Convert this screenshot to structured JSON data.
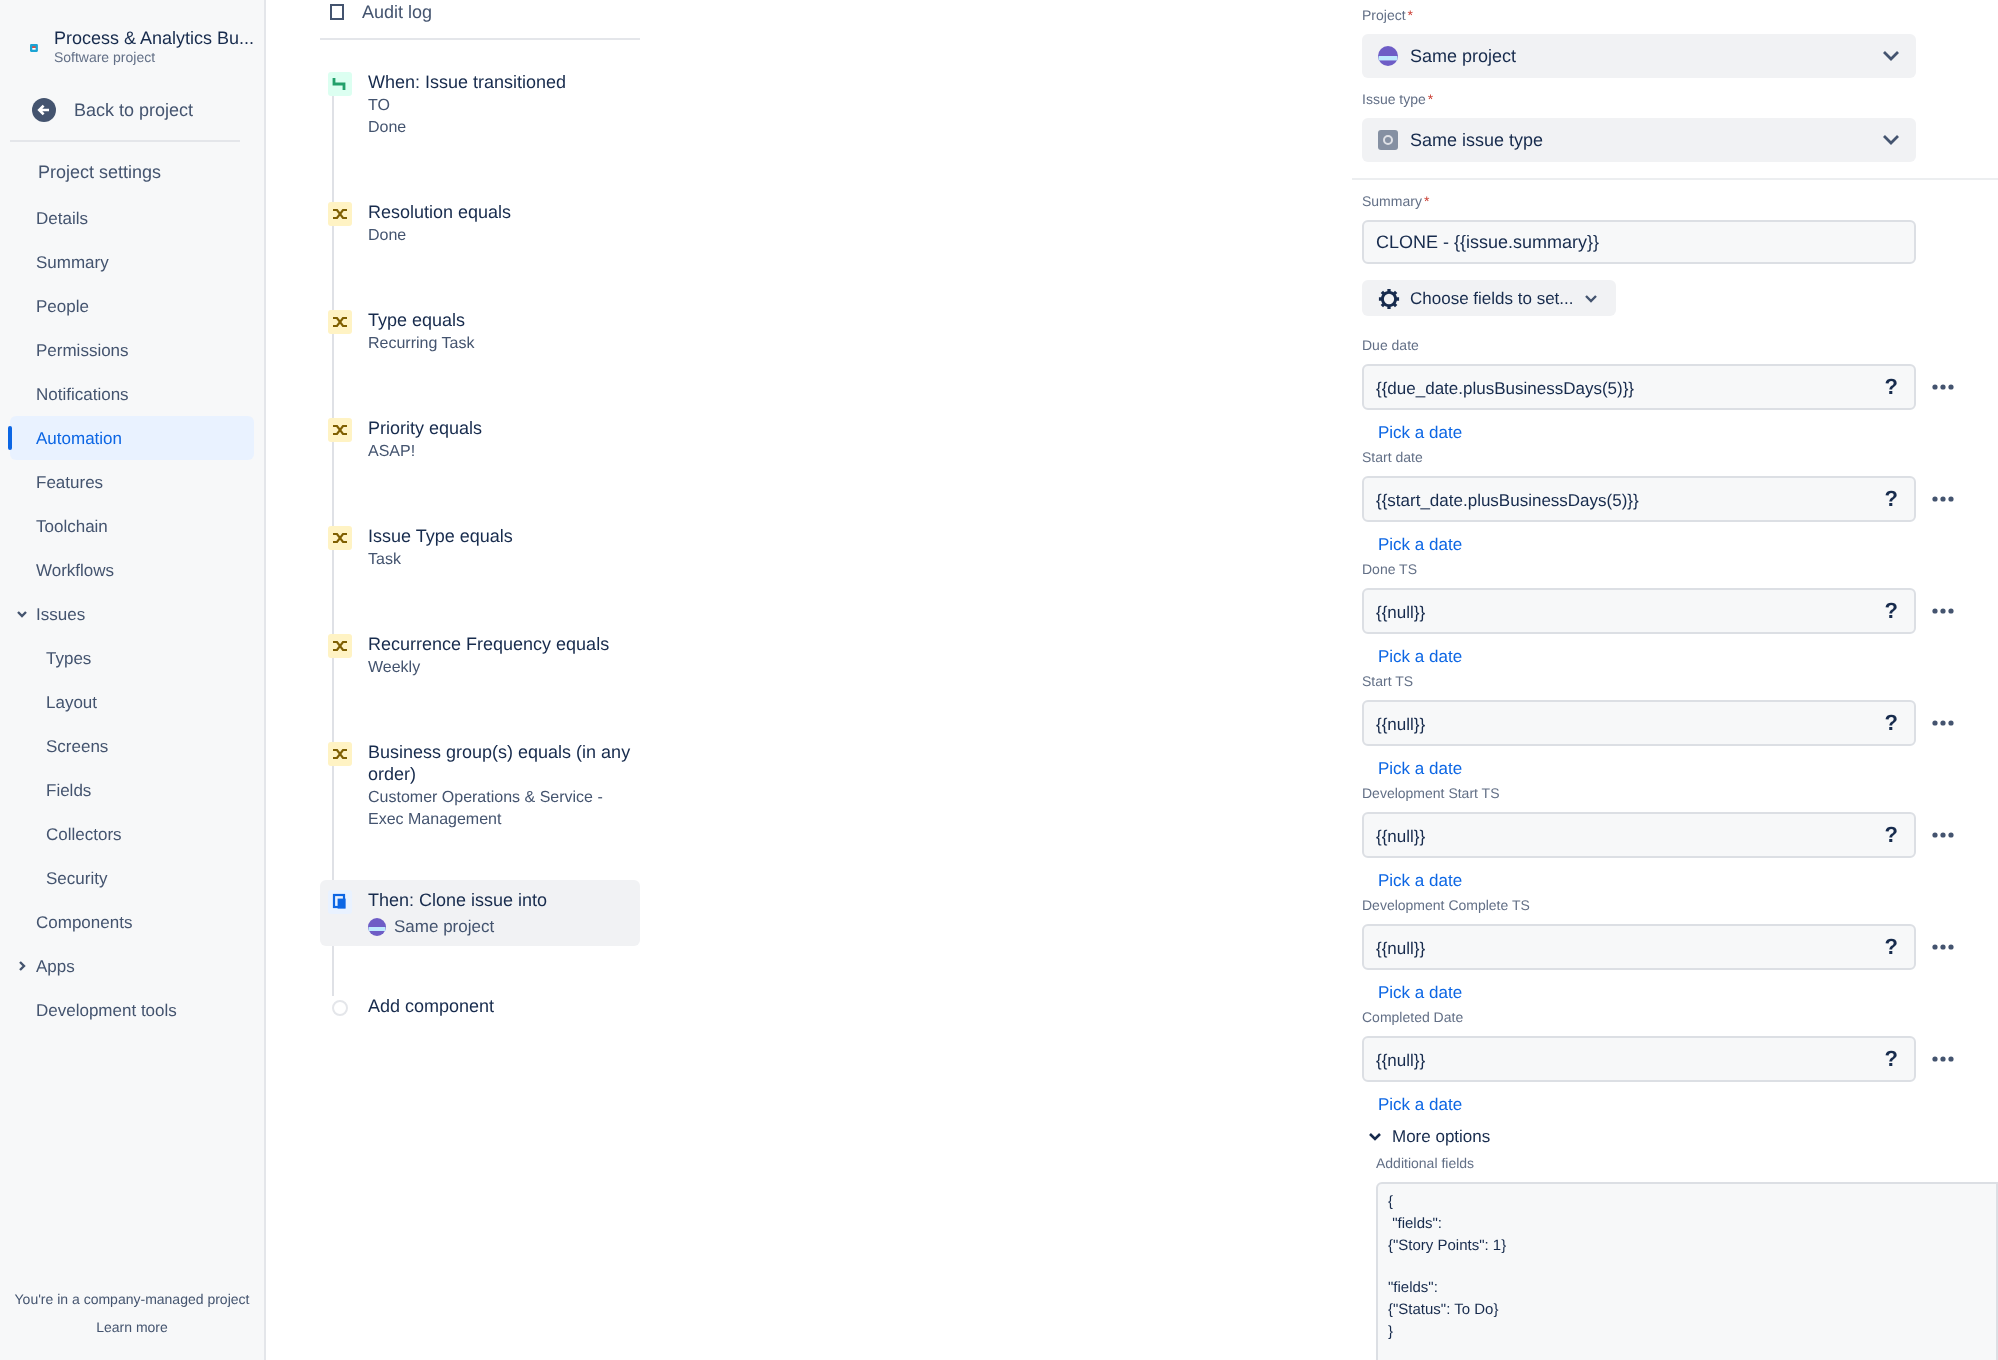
{
  "sidebar": {
    "project": {
      "name": "Process & Analytics Bu...",
      "type": "Software project"
    },
    "back_link": "Back to project",
    "section_title": "Project settings",
    "items": [
      {
        "label": "Details",
        "selected": false
      },
      {
        "label": "Summary",
        "selected": false
      },
      {
        "label": "People",
        "selected": false
      },
      {
        "label": "Permissions",
        "selected": false
      },
      {
        "label": "Notifications",
        "selected": false
      },
      {
        "label": "Automation",
        "selected": true
      },
      {
        "label": "Features",
        "selected": false
      },
      {
        "label": "Toolchain",
        "selected": false
      },
      {
        "label": "Workflows",
        "selected": false
      },
      {
        "label": "Issues",
        "selected": false,
        "expanded": true,
        "children": [
          {
            "label": "Types",
            "selected": false
          },
          {
            "label": "Layout",
            "selected": false
          },
          {
            "label": "Screens",
            "selected": false
          },
          {
            "label": "Fields",
            "selected": false
          },
          {
            "label": "Collectors",
            "selected": false
          },
          {
            "label": "Security",
            "selected": false
          }
        ]
      },
      {
        "label": "Components",
        "selected": false
      },
      {
        "label": "Apps",
        "selected": false,
        "expanded": false
      },
      {
        "label": "Development tools",
        "selected": false
      }
    ],
    "footer": {
      "text": "You're in a company-managed project",
      "link": "Learn more"
    }
  },
  "rule": {
    "audit_log": "Audit log",
    "steps": [
      {
        "kind": "trigger",
        "title": "When: Issue transitioned",
        "details": [
          "TO",
          "Done"
        ],
        "selected": false
      },
      {
        "kind": "condition",
        "title": "Resolution equals",
        "details": [
          "Done"
        ],
        "selected": false
      },
      {
        "kind": "condition",
        "title": "Type equals",
        "details": [
          "Recurring Task"
        ],
        "selected": false
      },
      {
        "kind": "condition",
        "title": "Priority equals",
        "details": [
          "ASAP!"
        ],
        "selected": false
      },
      {
        "kind": "condition",
        "title": "Issue Type equals",
        "details": [
          "Task"
        ],
        "selected": false
      },
      {
        "kind": "condition",
        "title": "Recurrence Frequency equals",
        "details": [
          "Weekly"
        ],
        "selected": false
      },
      {
        "kind": "condition",
        "title": "Business group(s) equals (in any order)",
        "details": [
          "Customer Operations & Service - Exec Management"
        ],
        "selected": false
      },
      {
        "kind": "action",
        "title": "Then: Clone issue into",
        "project": "Same project",
        "selected": true
      },
      {
        "kind": "add",
        "title": "Add component",
        "selected": false
      }
    ]
  },
  "form": {
    "selects": [
      {
        "kind": "project",
        "label": "Project",
        "required_mark": "*",
        "value": "Same project"
      },
      {
        "kind": "issue_type",
        "label": "Issue type",
        "required_mark": "*",
        "value": "Same issue type"
      }
    ],
    "summary": {
      "label": "Summary",
      "required_mark": "*",
      "value": "CLONE - {{issue.summary}}"
    },
    "choose_fields_button": "Choose fields to set...",
    "date_fields": [
      {
        "label": "Due date",
        "value": "{{due_date.plusBusinessDays(5)}}",
        "help": "?",
        "link": "Pick a date"
      },
      {
        "label": "Start date",
        "value": "{{start_date.plusBusinessDays(5)}}",
        "help": "?",
        "link": "Pick a date"
      },
      {
        "label": "Done TS",
        "value": "{{null}}",
        "help": "?",
        "link": "Pick a date"
      },
      {
        "label": "Start TS",
        "value": "{{null}}",
        "help": "?",
        "link": "Pick a date"
      },
      {
        "label": "Development Start TS",
        "value": "{{null}}",
        "help": "?",
        "link": "Pick a date"
      },
      {
        "label": "Development Complete TS",
        "value": "{{null}}",
        "help": "?",
        "link": "Pick a date"
      },
      {
        "label": "Completed Date",
        "value": "{{null}}",
        "help": "?",
        "link": "Pick a date"
      }
    ],
    "more_options": {
      "label": "More options",
      "expanded": true
    },
    "additional_fields": {
      "label": "Additional fields",
      "value": "{\n \"fields\":\n{\"Story Points\": 1}\n\n\"fields\":\n{\"Status\": To Do}\n}"
    }
  }
}
